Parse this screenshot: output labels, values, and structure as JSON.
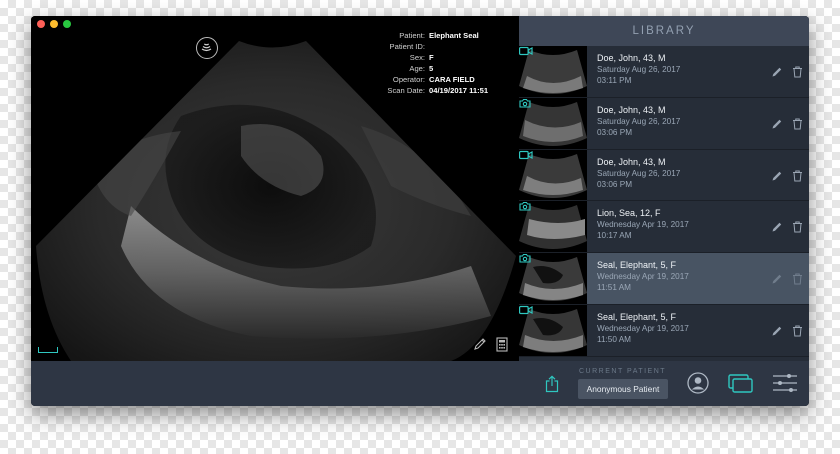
{
  "viewer": {
    "metadata": [
      {
        "label": "Patient:",
        "value": "Elephant Seal"
      },
      {
        "label": "Patient ID:",
        "value": ""
      },
      {
        "label": "Sex:",
        "value": "F"
      },
      {
        "label": "Age:",
        "value": "5"
      },
      {
        "label": "Operator:",
        "value": "CARA  FIELD"
      },
      {
        "label": "Scan Date:",
        "value": "04/19/2017 11:51"
      }
    ],
    "icons": {
      "probe": "ultrasound-probe-icon",
      "annotate": "pencil-icon",
      "measure": "calculator-icon"
    }
  },
  "library": {
    "title": "LIBRARY",
    "items": [
      {
        "name": "Doe, John, 43, M",
        "date": "Saturday Aug 26, 2017",
        "time": "03:11 PM",
        "media": "video",
        "selected": false
      },
      {
        "name": "Doe, John, 43, M",
        "date": "Saturday Aug 26, 2017",
        "time": "03:06 PM",
        "media": "photo",
        "selected": false
      },
      {
        "name": "Doe, John, 43, M",
        "date": "Saturday Aug 26, 2017",
        "time": "03:06 PM",
        "media": "video",
        "selected": false
      },
      {
        "name": "Lion, Sea, 12, F",
        "date": "Wednesday Apr 19, 2017",
        "time": "10:17 AM",
        "media": "photo",
        "selected": false
      },
      {
        "name": "Seal, Elephant, 5, F",
        "date": "Wednesday Apr 19, 2017",
        "time": "11:51 AM",
        "media": "photo",
        "selected": true
      },
      {
        "name": "Seal, Elephant, 5, F",
        "date": "Wednesday Apr 19, 2017",
        "time": "11:50 AM",
        "media": "video",
        "selected": false
      }
    ]
  },
  "bottom_bar": {
    "current_patient_label": "CURRENT PATIENT",
    "current_patient_button": "Anonymous Patient",
    "icons": [
      "share-icon",
      "person-icon",
      "library-icon",
      "settings-sliders-icon"
    ]
  },
  "colors": {
    "accent": "#2fc7c0",
    "panel": "#262d38",
    "header": "#3e4757",
    "selected_row": "#485463",
    "bottom_bar": "#2e3644"
  }
}
